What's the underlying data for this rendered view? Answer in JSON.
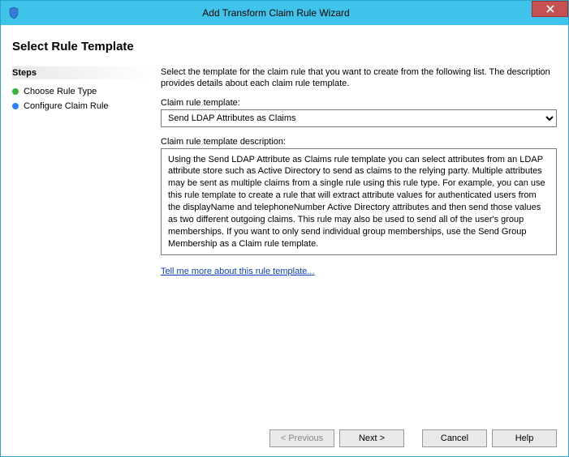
{
  "window": {
    "title": "Add Transform Claim Rule Wizard"
  },
  "header": {
    "title": "Select Rule Template"
  },
  "steps": {
    "header": "Steps",
    "items": [
      {
        "label": "Choose Rule Type",
        "bullet": "green"
      },
      {
        "label": "Configure Claim Rule",
        "bullet": "blue"
      }
    ]
  },
  "content": {
    "instruction": "Select the template for the claim rule that you want to create from the following list. The description provides details about each claim rule template.",
    "template_label": "Claim rule template:",
    "template_value": "Send LDAP Attributes as Claims",
    "desc_label": "Claim rule template description:",
    "desc_text": "Using the Send LDAP Attribute as Claims rule template you can select attributes from an LDAP attribute store such as Active Directory to send as claims to the relying party. Multiple attributes may be sent as multiple claims from a single rule using this rule type. For example, you can use this rule template to create a rule that will extract attribute values for authenticated users from the displayName and telephoneNumber Active Directory attributes and then send those values as two different outgoing claims. This rule may also be used to send all of the user's group memberships. If you want to only send individual group memberships, use the Send Group Membership as a Claim rule template.",
    "link_text": "Tell me more about this rule template..."
  },
  "footer": {
    "previous": "< Previous",
    "next": "Next >",
    "cancel": "Cancel",
    "help": "Help"
  }
}
